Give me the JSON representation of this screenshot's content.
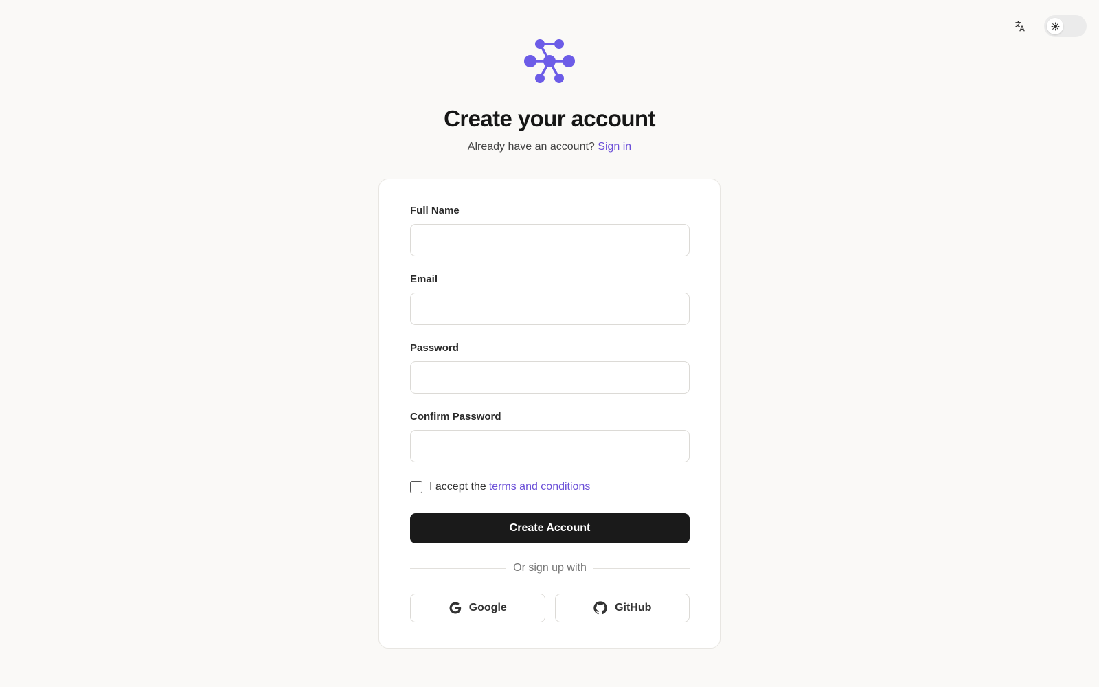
{
  "header": {
    "title": "Create your account",
    "subtitle_text": "Already have an account?",
    "signin_link": "Sign in"
  },
  "top_controls": {
    "language_icon": "translate-icon",
    "theme_icon": "sun-icon"
  },
  "form": {
    "fields": [
      {
        "label": "Full Name",
        "value": "",
        "placeholder": ""
      },
      {
        "label": "Email",
        "value": "",
        "placeholder": ""
      },
      {
        "label": "Password",
        "value": "",
        "placeholder": ""
      },
      {
        "label": "Confirm Password",
        "value": "",
        "placeholder": ""
      }
    ],
    "terms_prefix": "I accept the",
    "terms_link": "terms and conditions",
    "submit_label": "Create Account",
    "divider_text": "Or sign up with",
    "social": [
      {
        "label": "Google",
        "icon": "google-icon"
      },
      {
        "label": "GitHub",
        "icon": "github-icon"
      }
    ]
  },
  "colors": {
    "accent": "#6b4fd8",
    "logo": "#6c5ce7",
    "primary_button": "#1a1a1a",
    "background": "#faf9f7"
  }
}
